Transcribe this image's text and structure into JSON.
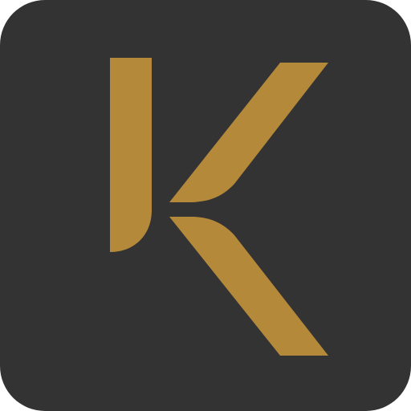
{
  "app_icon": {
    "logo_letter": "K",
    "icon_name": "k-logo-icon",
    "colors": {
      "background": "#333333",
      "accent": "#B5893A"
    }
  }
}
